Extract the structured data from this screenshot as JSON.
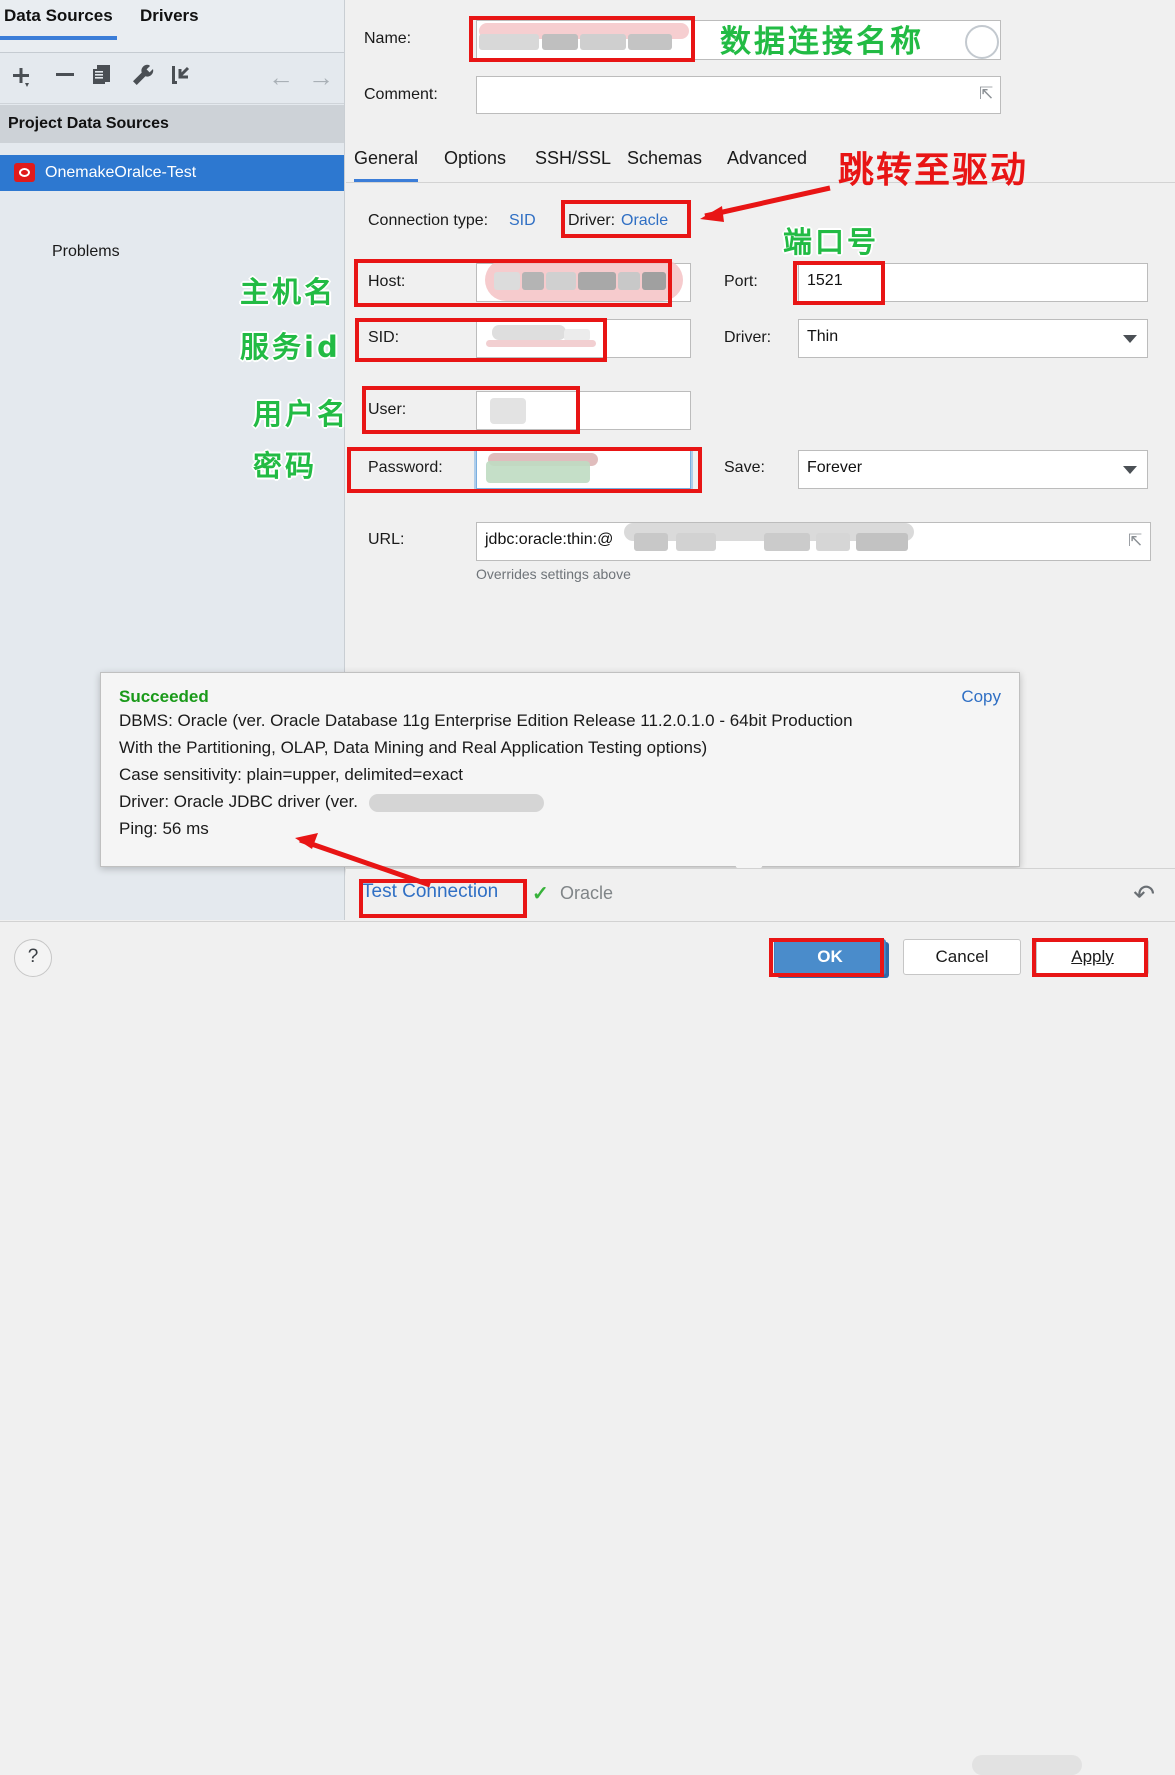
{
  "sidebar": {
    "tabs": [
      {
        "label": "Data Sources",
        "selected": true
      },
      {
        "label": "Drivers",
        "selected": false
      }
    ],
    "toolbar_icons": [
      "add-icon",
      "remove-icon",
      "copy-icon",
      "wrench-icon",
      "import-icon",
      "back-arrow-icon",
      "forward-arrow-icon"
    ],
    "group_header": "Project Data Sources",
    "datasource": {
      "label": "OnemakeOralce-Test",
      "icon": "oracle-icon"
    },
    "problems_label": "Problems"
  },
  "form": {
    "name_label": "Name:",
    "name_value": "",
    "comment_label": "Comment:",
    "comment_value": "",
    "tabs": [
      {
        "label": "General",
        "selected": true
      },
      {
        "label": "Options",
        "selected": false
      },
      {
        "label": "SSH/SSL",
        "selected": false
      },
      {
        "label": "Schemas",
        "selected": false
      },
      {
        "label": "Advanced",
        "selected": false
      }
    ],
    "connection_type_label": "Connection type:",
    "connection_type_value": "SID",
    "driver_label": "Driver:",
    "driver_value": "Oracle",
    "host_label": "Host:",
    "host_value": "",
    "port_label": "Port:",
    "port_value": "1521",
    "sid_label": "SID:",
    "sid_value": "",
    "driver_kind_label": "Driver:",
    "driver_kind_value": "Thin",
    "user_label": "User:",
    "user_value": "",
    "password_label": "Password:",
    "password_value": "",
    "save_label": "Save:",
    "save_value": "Forever",
    "url_label": "URL:",
    "url_value": "jdbc:oracle:thin:@",
    "url_hint": "Overrides settings above"
  },
  "result_popup": {
    "status": "Succeeded",
    "copy_label": "Copy",
    "lines": [
      "DBMS: Oracle (ver. Oracle Database 11g Enterprise Edition Release 11.2.0.1.0 - 64bit Production",
      "With the Partitioning, OLAP, Data Mining and Real Application Testing options)",
      "Case sensitivity: plain=upper, delimited=exact",
      "Driver: Oracle JDBC driver (ver.",
      "Ping: 56 ms"
    ]
  },
  "test_bar": {
    "test_link": "Test Connection",
    "status_icon": "check-icon",
    "status_text": "Oracle",
    "undo_icon": "undo-icon"
  },
  "buttons": {
    "help": "?",
    "ok": "OK",
    "cancel": "Cancel",
    "apply": "Apply"
  },
  "annotations": {
    "name_cn": "数据连接名称",
    "driver_cn": "跳转至驱动",
    "port_cn": "端口号",
    "host_cn": "主机名",
    "sid_cn": "服务id",
    "user_cn": "用户名",
    "password_cn": "密码"
  },
  "colors": {
    "accent": "#3b7dd8",
    "annotation_red": "#e81515",
    "annotation_green": "#22bb44",
    "success_green": "#1a9a1a",
    "link_blue": "#2f6fc4"
  }
}
